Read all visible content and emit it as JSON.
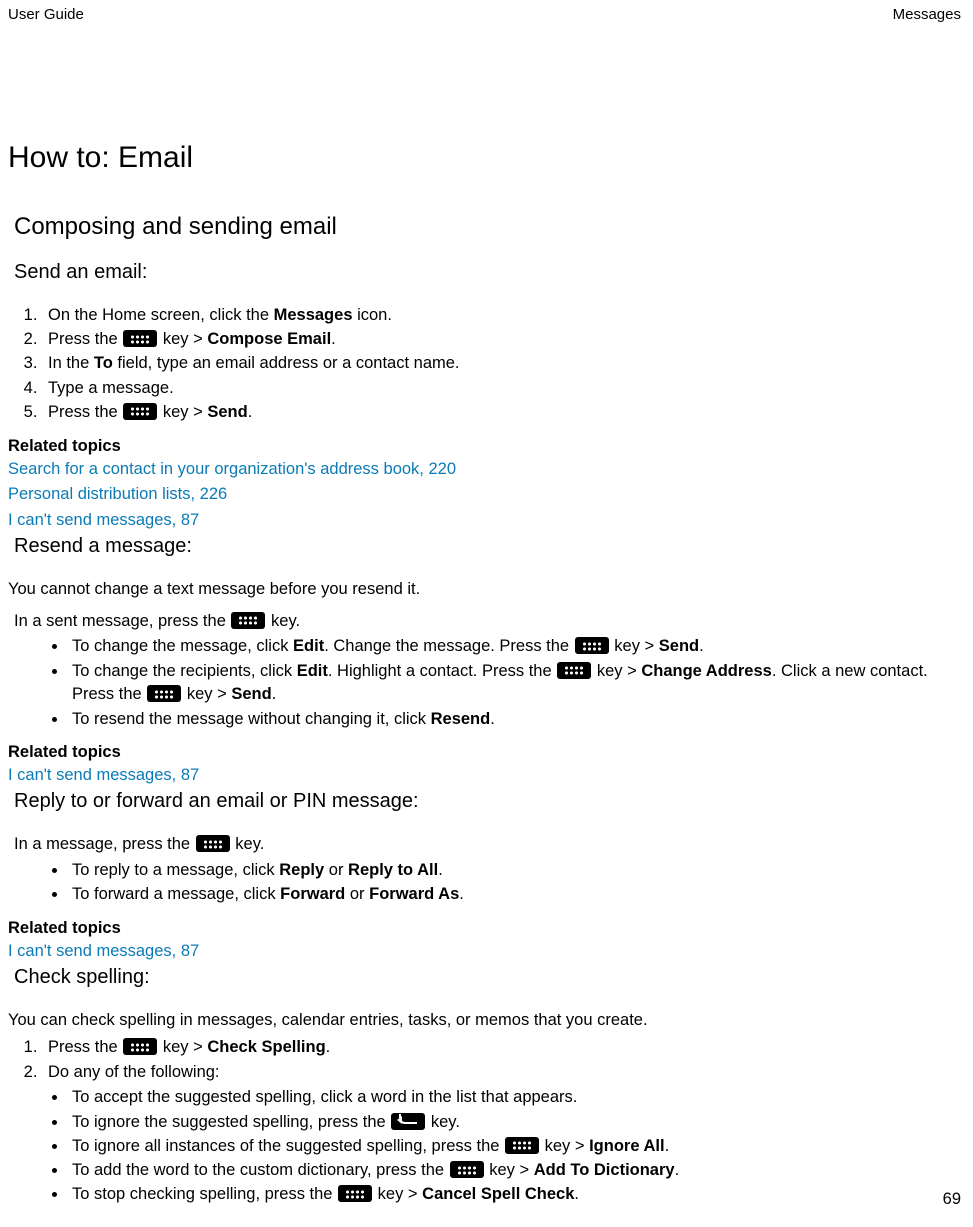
{
  "header": {
    "left": "User Guide",
    "right": "Messages"
  },
  "h1": "How to: Email",
  "section1": {
    "heading": "Composing and sending email",
    "sub_send": {
      "heading": "Send an email:",
      "step1_a": "On the Home screen, click the ",
      "step1_b": "Messages",
      "step1_c": " icon.",
      "step2_a": "Press the ",
      "step2_b": " key > ",
      "step2_c": "Compose Email",
      "step2_d": ".",
      "step3_a": "In the ",
      "step3_b": "To",
      "step3_c": " field, type an email address or a contact name.",
      "step4": "Type a message.",
      "step5_a": "Press the ",
      "step5_b": " key > ",
      "step5_c": "Send",
      "step5_d": ".",
      "related_heading": "Related topics",
      "related_links": [
        "Search for a contact in your organization's address book, 220",
        "Personal distribution lists, 226",
        "I can't send messages, 87"
      ]
    },
    "sub_resend": {
      "heading": "Resend a message:",
      "intro": "You cannot change a text message before you resend it.",
      "line1_a": "In a sent message, press the ",
      "line1_b": " key.",
      "b1_a": "To change the message, click ",
      "b1_b": "Edit",
      "b1_c": ". Change the message. Press the ",
      "b1_d": " key > ",
      "b1_e": "Send",
      "b1_f": ".",
      "b2_a": "To change the recipients, click ",
      "b2_b": "Edit",
      "b2_c": ". Highlight a contact. Press the ",
      "b2_d": " key > ",
      "b2_e": "Change Address",
      "b2_f": ". Click a new contact. Press the ",
      "b2_g": " key > ",
      "b2_h": "Send",
      "b2_i": ".",
      "b3_a": "To resend the message without changing it, click ",
      "b3_b": "Resend",
      "b3_c": ".",
      "related_heading": "Related topics",
      "related_link": "I can't send messages, 87"
    },
    "sub_reply": {
      "heading": "Reply to or forward an email or PIN message:",
      "line1_a": "In a message, press the ",
      "line1_b": " key.",
      "b1_a": "To reply to a message, click ",
      "b1_b": "Reply",
      "b1_c": " or ",
      "b1_d": "Reply to All",
      "b1_e": ".",
      "b2_a": "To forward a message, click ",
      "b2_b": "Forward",
      "b2_c": " or ",
      "b2_d": "Forward As",
      "b2_e": ".",
      "related_heading": "Related topics",
      "related_link": "I can't send messages, 87"
    },
    "sub_spell": {
      "heading": "Check spelling:",
      "intro": "You can check spelling in messages, calendar entries, tasks, or memos that you create.",
      "s1_a": "Press the ",
      "s1_b": " key > ",
      "s1_c": "Check Spelling",
      "s1_d": ".",
      "s2": "Do any of the following:",
      "b1": "To accept the suggested spelling, click a word in the list that appears.",
      "b2_a": "To ignore the suggested spelling, press the ",
      "b2_b": " key.",
      "b3_a": "To ignore all instances of the suggested spelling, press the ",
      "b3_b": " key > ",
      "b3_c": "Ignore All",
      "b3_d": ".",
      "b4_a": "To add the word to the custom dictionary, press the ",
      "b4_b": " key > ",
      "b4_c": "Add To Dictionary",
      "b4_d": ".",
      "b5_a": "To stop checking spelling, press the ",
      "b5_b": " key > ",
      "b5_c": "Cancel Spell Check",
      "b5_d": "."
    }
  },
  "page_number": "69"
}
